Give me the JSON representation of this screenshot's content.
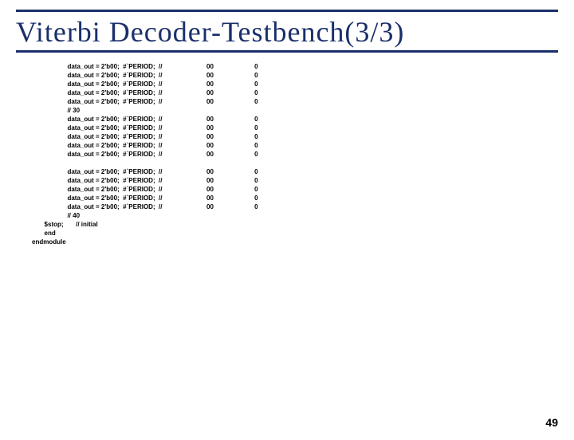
{
  "title": "Viterbi Decoder-Testbench(3/3)",
  "code": "                    data_out = 2'b00;  #`PERIOD;  //                         00                       0\n                    data_out = 2'b00;  #`PERIOD;  //                         00                       0\n                    data_out = 2'b00;  #`PERIOD;  //                         00                       0\n                    data_out = 2'b00;  #`PERIOD;  //                         00                       0\n                    data_out = 2'b00;  #`PERIOD;  //                         00                       0\n                    // 30\n                    data_out = 2'b00;  #`PERIOD;  //                         00                       0\n                    data_out = 2'b00;  #`PERIOD;  //                         00                       0\n                    data_out = 2'b00;  #`PERIOD;  //                         00                       0\n                    data_out = 2'b00;  #`PERIOD;  //                         00                       0\n                    data_out = 2'b00;  #`PERIOD;  //                         00                       0\n\n                    data_out = 2'b00;  #`PERIOD;  //                         00                       0\n                    data_out = 2'b00;  #`PERIOD;  //                         00                       0\n                    data_out = 2'b00;  #`PERIOD;  //                         00                       0\n                    data_out = 2'b00;  #`PERIOD;  //                         00                       0\n                    data_out = 2'b00;  #`PERIOD;  //                         00                       0\n                    // 40\n       $stop;       // initial\n       end\nendmodule",
  "page": "49"
}
